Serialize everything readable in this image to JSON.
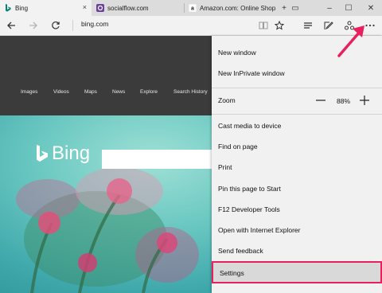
{
  "tabs": [
    {
      "title": "Bing",
      "close": "×",
      "favicon": "bing-favicon"
    },
    {
      "title": "socialflow.com",
      "favicon": "socialflow-favicon"
    },
    {
      "title": "Amazon.com: Online Shop",
      "favicon": "amazon-favicon"
    }
  ],
  "tab_actions": {
    "new_tab": "+",
    "tab_preview": "▭"
  },
  "window_controls": {
    "minimize": "–",
    "maximize": "☐",
    "close": "✕"
  },
  "address_bar": {
    "url": "bing.com"
  },
  "bing": {
    "nav_links": [
      "Images",
      "Videos",
      "Maps",
      "News",
      "Explore",
      "Search History"
    ],
    "logo_text": "Bing"
  },
  "menu": {
    "new_window": "New window",
    "new_inprivate": "New InPrivate window",
    "zoom_label": "Zoom",
    "zoom_value": "88%",
    "zoom_minus": "—",
    "zoom_plus": "+",
    "cast": "Cast media to device",
    "find": "Find on page",
    "print": "Print",
    "pin": "Pin this page to Start",
    "devtools": "F12 Developer Tools",
    "open_ie": "Open with Internet Explorer",
    "feedback": "Send feedback",
    "settings": "Settings"
  },
  "colors": {
    "highlight": "#e8215e",
    "bing_nav_bg": "#3b3b3b",
    "menu_bg": "#f1f1f1"
  }
}
